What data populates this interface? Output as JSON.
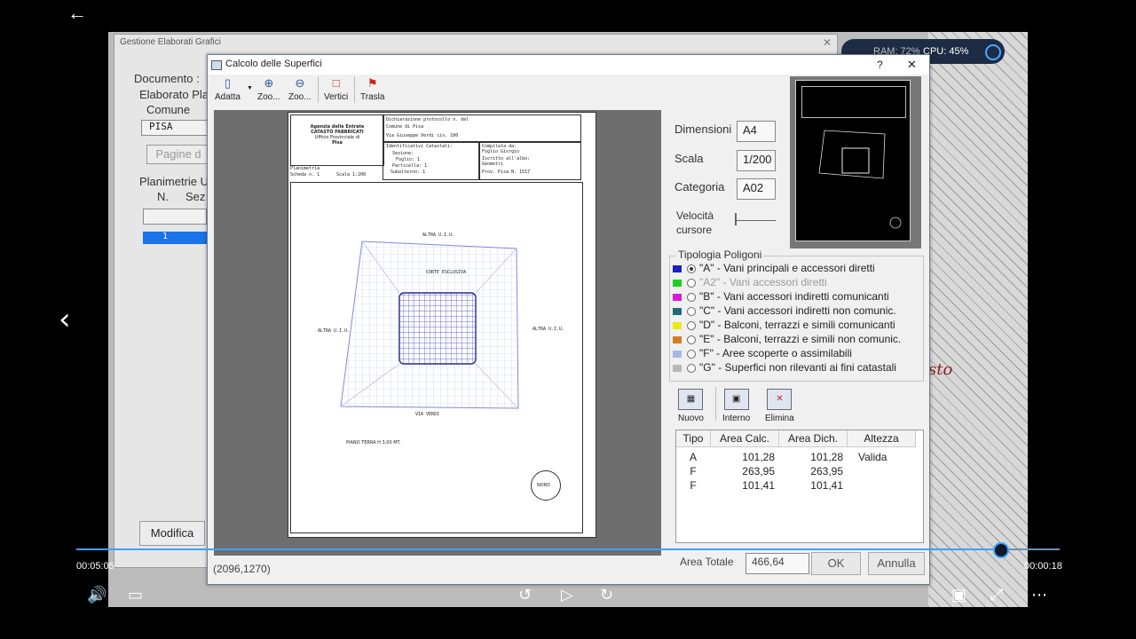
{
  "player": {
    "time_elapsed": "00:05:05",
    "time_remaining": "00:00:18",
    "progress_fraction": 0.941
  },
  "bg_window": {
    "title": "Gestione Elaborati Grafici",
    "documento_label": "Documento :",
    "elaborato_label": "Elaborato Pla",
    "comune_label": "Comune",
    "comune_value": "PISA",
    "pagine_label": "Pagine d",
    "planimetrie_label": "Planimetrie U",
    "col_n": "N.",
    "col_sez": "Sez",
    "row_1": "1",
    "modifica_label": "Modifica"
  },
  "monitor": {
    "ram": "RAM: 72%",
    "cpu": "CPU: 45%"
  },
  "window": {
    "title": "Calcolo delle Superfici",
    "help": "?",
    "close": "✕",
    "toolbar": [
      {
        "label": "Adatta",
        "icon": "fit-page-icon"
      },
      {
        "label": "Zoo...",
        "icon": "zoom-in-icon"
      },
      {
        "label": "Zoo...",
        "icon": "zoom-out-icon"
      },
      {
        "label": "Vertici",
        "icon": "vertices-icon"
      },
      {
        "label": "Trasla",
        "icon": "move-icon"
      }
    ],
    "dimensioni_label": "Dimensioni",
    "dimensioni_value": "A4",
    "scala_label": "Scala",
    "scala_value": "1/200",
    "categoria_label": "Categoria",
    "categoria_value": "A02",
    "velocita_label1": "Velocità",
    "velocita_label2": "cursore",
    "tipologia_label": "Tipologia Poligoni",
    "polygons": [
      {
        "text": "\"A\" - Vani principali e accessori diretti",
        "color": "#1c1cc8",
        "selected": true,
        "disabled": false
      },
      {
        "text": "\"A2\" - Vani accessori diretti",
        "color": "#22cc22",
        "selected": false,
        "disabled": true
      },
      {
        "text": "\"B\" - Vani accessori indiretti comunicanti",
        "color": "#d81ad8",
        "selected": false,
        "disabled": false
      },
      {
        "text": "\"C\" - Vani accessori indiretti non comunic.",
        "color": "#1d6b7a",
        "selected": false,
        "disabled": false
      },
      {
        "text": "\"D\" - Balconi, terrazzi e simili comunicanti",
        "color": "#eaea10",
        "selected": false,
        "disabled": false
      },
      {
        "text": "\"E\" - Balconi, terrazzi e simili non comunic.",
        "color": "#d87a22",
        "selected": false,
        "disabled": false
      },
      {
        "text": "\"F\" - Aree scoperte o assimilabili",
        "color": "#a8b6e8",
        "selected": false,
        "disabled": false
      },
      {
        "text": "\"G\" - Superfici non rilevanti ai fini catastali",
        "color": "#b8b8b8",
        "selected": false,
        "disabled": false
      }
    ],
    "actions": {
      "nuovo": "Nuovo",
      "interno": "Interno",
      "elimina": "Elimina"
    },
    "table": {
      "headers": [
        "Tipo",
        "Area Calc.",
        "Area Dich.",
        "Altezza"
      ],
      "rows": [
        [
          "A",
          "101,28",
          "101,28",
          "Valida"
        ],
        [
          "F",
          "263,95",
          "263,95",
          ""
        ],
        [
          "F",
          "101,41",
          "101,41",
          ""
        ]
      ]
    },
    "area_totale_label": "Area Totale",
    "area_totale_value": "466,64",
    "ok_label": "OK",
    "annulla_label": "Annulla",
    "status_coords": "(2096,1270)"
  },
  "paper": {
    "agency1": "Agenzia delle Entrate",
    "agency2": "CATASTO FABBRICATI",
    "agency3": "Ufficio Provinciale di",
    "agency4": "Pisa",
    "planimetria": "Planimetria",
    "scheda": "Scheda n. 1",
    "scala": "Scala 1:200",
    "dich1": "Dichiarazione protocollo n.        del",
    "dich2": "Comune di Pisa",
    "dich3": "Via Giuseppe Verdi                    civ. 100",
    "ident": "Identificativi Catastali:",
    "sezione": "Sezione:",
    "foglio": "Foglio: 1",
    "particella": "Particella: 1",
    "subalterno": "Subalterno: 1",
    "compilata": "Compilata da:",
    "compilata2": "Foglio Giorgio",
    "iscritto": "Iscritto all'albo:",
    "iscritto2": "Geometri",
    "prov": "Prov. Pisa          N. 1517",
    "altra_top": "ALTRA U.I.U.",
    "altra_left": "ALTRA U.I.U.",
    "altra_right": "ALTRA U.I.U.",
    "via": "VIA VERDI",
    "corte": "CORTE ESCLUSIVA",
    "piano": "PIANO TERRA H 3,00 MT.",
    "nord": "NORD"
  }
}
